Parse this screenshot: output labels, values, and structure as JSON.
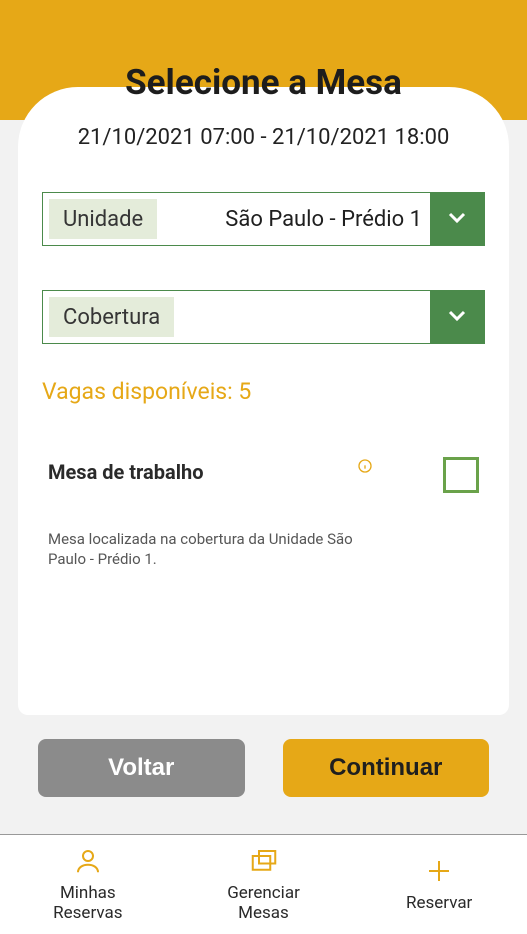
{
  "header": {
    "title": "Selecione a Mesa"
  },
  "date_range": "21/10/2021 07:00 - 21/10/2021 18:00",
  "unit_select": {
    "label": "Unidade",
    "value": "São Paulo - Prédio 1"
  },
  "floor_select": {
    "label": "Cobertura",
    "value": ""
  },
  "slots_text": "Vagas disponíveis: 5",
  "item": {
    "title": "Mesa de trabalho",
    "description": "Mesa localizada na cobertura da Unidade São Paulo - Prédio 1."
  },
  "actions": {
    "back": "Voltar",
    "continue": "Continuar"
  },
  "nav": {
    "my_reservations": "Minhas Reservas",
    "manage_tables": "Gerenciar Mesas",
    "reserve": "Reservar"
  },
  "colors": {
    "accent": "#e6a817",
    "select_green": "#4b8a4b"
  }
}
